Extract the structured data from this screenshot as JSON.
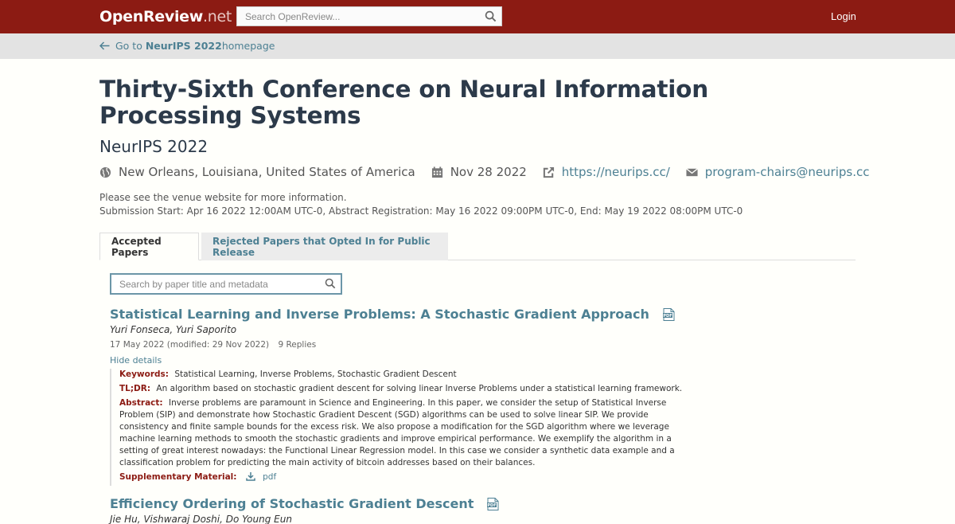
{
  "topbar": {
    "logo_main": "OpenReview",
    "logo_suffix": ".net",
    "search_placeholder": "Search OpenReview...",
    "login_label": "Login"
  },
  "subbar": {
    "back_prefix": "Go to ",
    "back_venue": "NeurIPS 2022",
    "back_suffix": " homepage"
  },
  "venue": {
    "title": "Thirty-Sixth Conference on Neural Information Processing Systems",
    "subtitle": "NeurIPS 2022",
    "location": "New Orleans, Louisiana, United States of America",
    "date": "Nov 28 2022",
    "website": "https://neurips.cc/",
    "email": "program-chairs@neurips.cc",
    "info_line1": "Please see the venue website for more information.",
    "info_line2": "Submission Start: Apr 16 2022 12:00AM UTC-0, Abstract Registration: May 16 2022 09:00PM UTC-0, End: May 19 2022 08:00PM UTC-0"
  },
  "tabs": [
    {
      "label": "Accepted Papers",
      "active": true
    },
    {
      "label": "Rejected Papers that Opted In for Public Release",
      "active": false
    }
  ],
  "paper_search": {
    "placeholder": "Search by paper title and metadata"
  },
  "papers": [
    {
      "title": "Statistical Learning and Inverse Problems: A Stochastic Gradient Approach",
      "authors": "Yuri Fonseca, Yuri Saporito",
      "dates": "17 May 2022 (modified: 29 Nov 2022)",
      "replies": "9 Replies",
      "hide_details": "Hide details",
      "keywords_label": "Keywords:",
      "keywords": "Statistical Learning, Inverse Problems, Stochastic Gradient Descent",
      "tldr_label": "TL;DR:",
      "tldr": "An algorithm based on stochastic gradient descent for solving linear Inverse Problems under a statistical learning framework.",
      "abstract_label": "Abstract:",
      "abstract": "Inverse problems are paramount in Science and Engineering. In this paper, we consider the setup of Statistical Inverse Problem (SIP) and demonstrate how Stochastic Gradient Descent (SGD) algorithms can be used to solve linear SIP. We provide consistency and finite sample bounds for the excess risk. We also propose a modification for the SGD algorithm where we leverage machine learning methods to smooth the stochastic gradients and improve empirical performance. We exemplify the algorithm in a setting of great interest nowadays: the Functional Linear Regression model. In this case we consider a synthetic data example and a classification problem for predicting the main activity of bitcoin addresses based on their balances.",
      "supp_label": "Supplementary Material:",
      "supp_link": "pdf"
    },
    {
      "title": "Efficiency Ordering of Stochastic Gradient Descent",
      "authors": "Jie Hu, Vishwaraj Doshi, Do Young Eun"
    }
  ],
  "colors": {
    "brand": "#8c1b13",
    "link": "#4d8093",
    "title": "#2c3a4a"
  },
  "icons": {
    "search": "search-icon",
    "globe": "globe-icon",
    "calendar": "calendar-icon",
    "external": "external-link-icon",
    "email": "envelope-icon",
    "pdf": "pdf-icon",
    "download": "download-icon"
  }
}
